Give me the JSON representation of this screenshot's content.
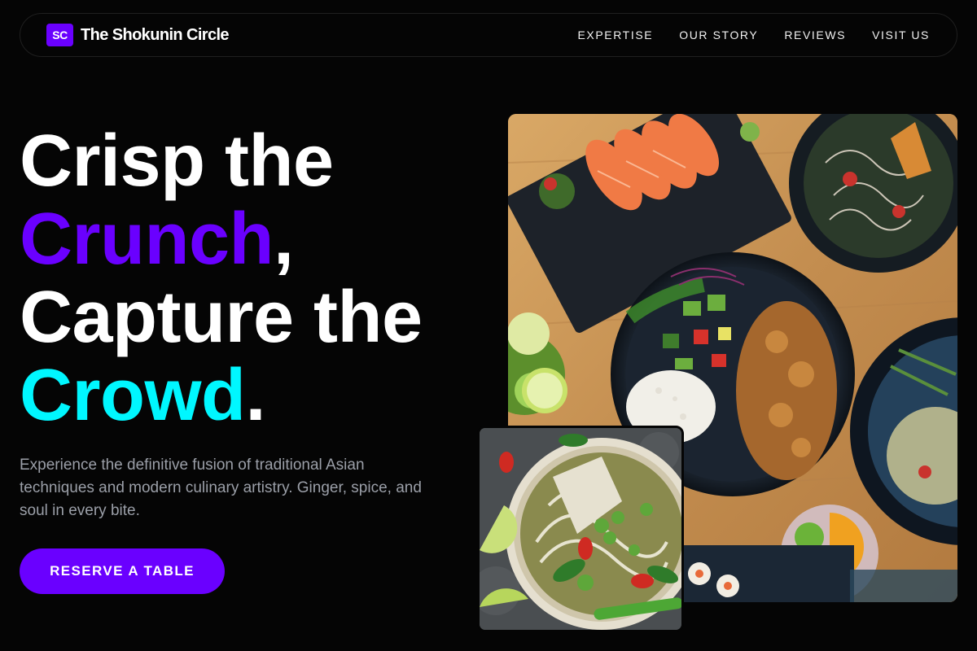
{
  "brand": {
    "logo_text": "SC",
    "name": "The Shokunin Circle"
  },
  "nav": {
    "links": [
      {
        "label": "EXPERTISE"
      },
      {
        "label": "OUR STORY"
      },
      {
        "label": "REVIEWS"
      },
      {
        "label": "VISIT US"
      }
    ]
  },
  "hero": {
    "headline_line1": "Crisp the",
    "headline_word2": "Crunch",
    "headline_punct2": ",",
    "headline_line3": "Capture the",
    "headline_word4": "Crowd",
    "headline_punct4": ".",
    "subtext": "Experience the definitive fusion of traditional Asian techniques and modern culinary artistry. Ginger, spice, and soul in every bite.",
    "cta_label": "RESERVE A TABLE"
  },
  "colors": {
    "background": "#050505",
    "accent_purple": "#6a00ff",
    "accent_cyan": "#00f7ff",
    "subtext_gray": "#9b9fa8"
  },
  "images": {
    "main_photo": "overhead-asian-dishes-photo",
    "inset_photo": "noodle-soup-bowl-photo"
  }
}
